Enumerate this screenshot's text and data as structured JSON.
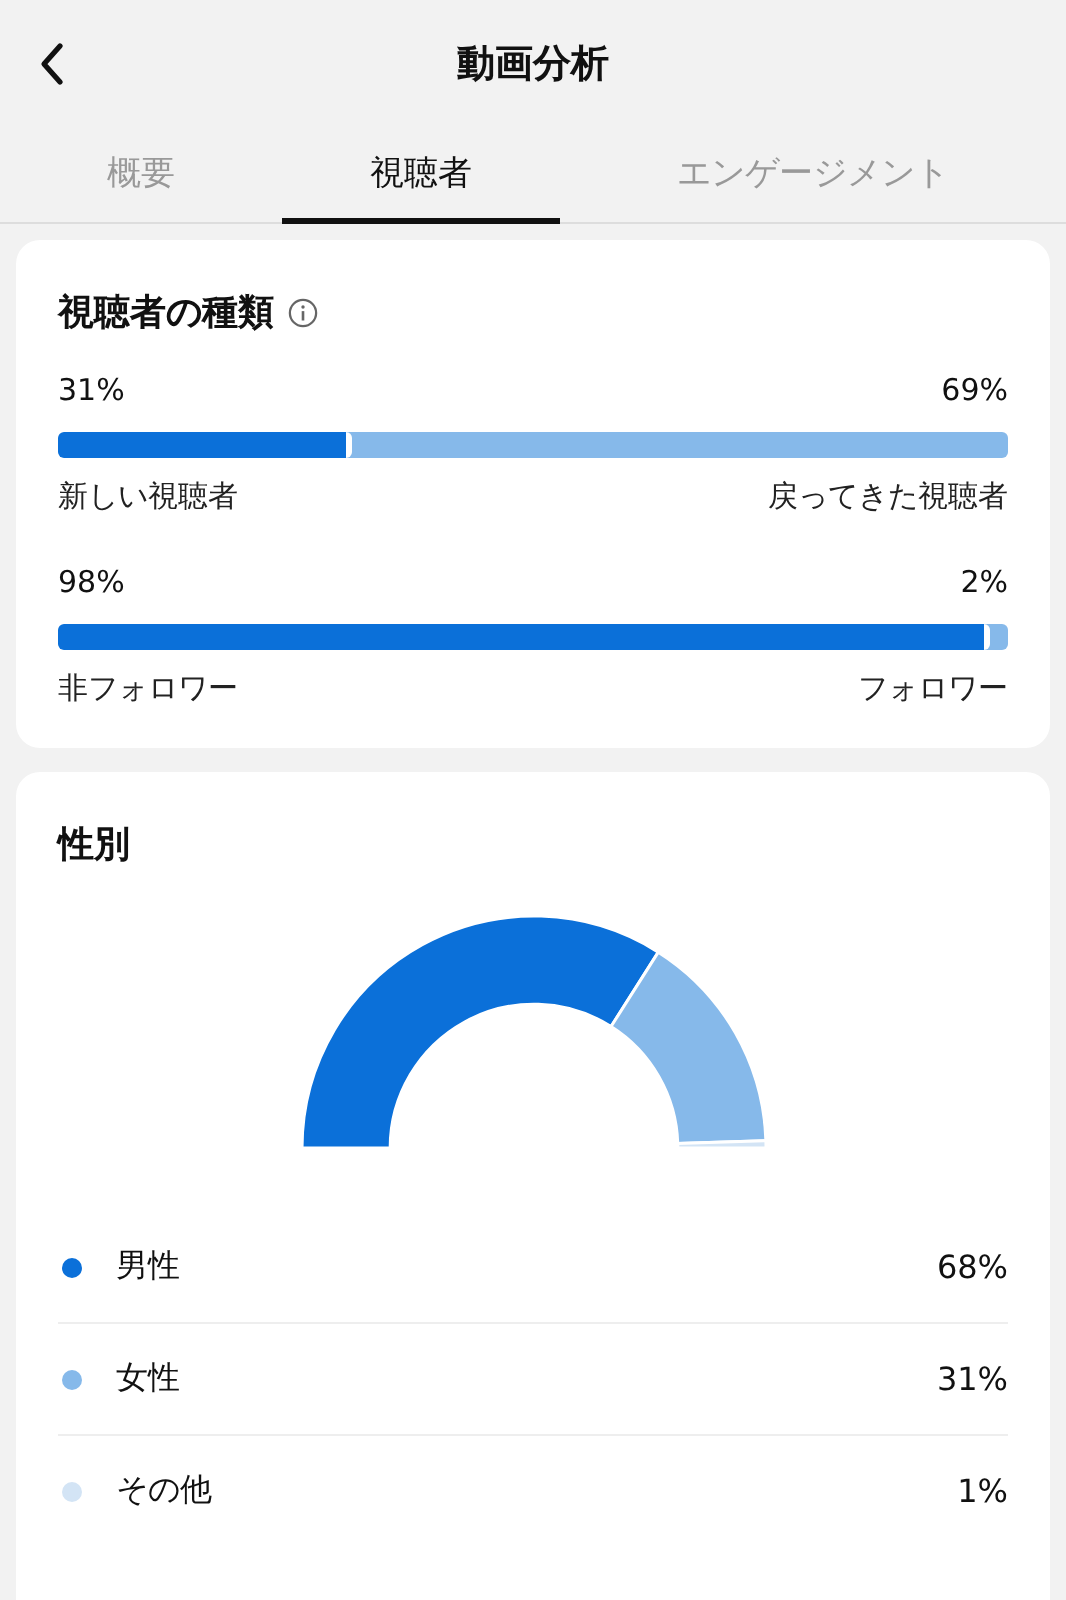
{
  "header": {
    "title": "動画分析"
  },
  "tabs": [
    {
      "label": "概要",
      "selected": false
    },
    {
      "label": "視聴者",
      "selected": true
    },
    {
      "label": "エンゲージメント",
      "selected": false
    }
  ],
  "viewer_types": {
    "title": "視聴者の種類",
    "bars": [
      {
        "left_value": "31%",
        "right_value": "69%",
        "level": 0.31,
        "left_label": "新しい視聴者",
        "right_label": "戻ってきた視聴者"
      },
      {
        "left_value": "98%",
        "right_value": "2%",
        "level": 0.98,
        "left_label": "非フォロワー",
        "right_label": "フォロワー"
      }
    ]
  },
  "gender": {
    "title": "性別",
    "chart_data": {
      "type": "donut",
      "categories": [
        "男性",
        "女性",
        "その他"
      ],
      "values": [
        68,
        31,
        1
      ],
      "colors": [
        "#0b70d9",
        "#86b9ea",
        "#d3e4f5"
      ]
    },
    "legend": [
      {
        "value": "68%",
        "color": "#0b70d9"
      },
      {
        "value": "31%",
        "color": "#86b9ea"
      },
      {
        "value": "1%",
        "color": "#d3e4f5"
      }
    ]
  }
}
